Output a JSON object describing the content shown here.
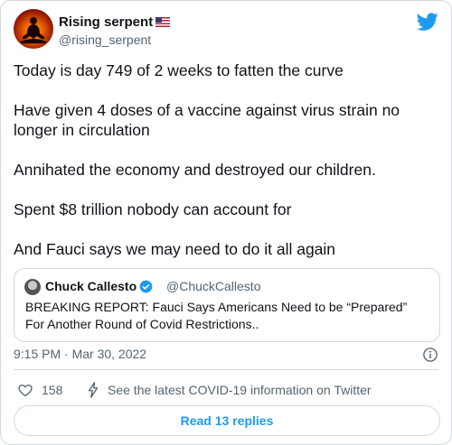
{
  "colors": {
    "accent": "#1d9bf0",
    "text": "#0f1419",
    "muted": "#536471",
    "border": "#cfd9de"
  },
  "author": {
    "name": "Rising serpent",
    "handle": "@rising_serpent",
    "flag": "us-flag-emoji",
    "avatar": "meditating-silhouette-avatar"
  },
  "tweet": {
    "paragraphs": [
      "Today is day 749 of 2 weeks to fatten the curve",
      "Have given 4 doses of a vaccine against virus strain no longer in circulation",
      "Annihated the economy and destroyed our children.",
      "Spent $8 trillion nobody can account for",
      "And Fauci says we may need to do it all again"
    ]
  },
  "quote": {
    "name": "Chuck Callesto",
    "handle": "@ChuckCallesto",
    "verified": true,
    "text": "BREAKING REPORT: Fauci Says Americans Need to be “Prepared” For Another Round of Covid Restrictions.."
  },
  "meta": {
    "timestamp": "9:15 PM · Mar 30, 2022"
  },
  "actions": {
    "like_count": "158",
    "covid_link": "See the latest COVID-19 information on Twitter"
  },
  "replies": {
    "label": "Read 13 replies"
  },
  "icons": {
    "logo": "twitter-bird-icon",
    "info": "info-icon",
    "like": "heart-icon",
    "covid": "lightning-bolt-icon",
    "verified": "verified-badge-icon"
  }
}
